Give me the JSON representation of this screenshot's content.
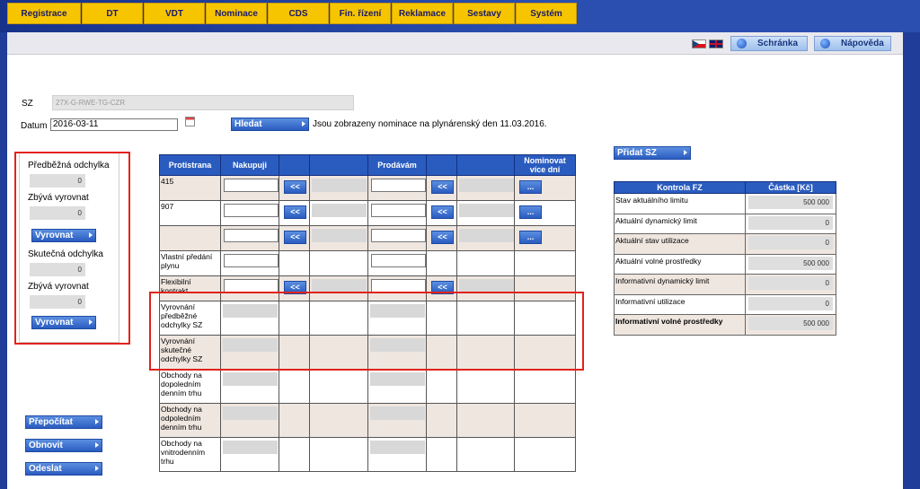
{
  "menu": {
    "items": [
      "Registrace",
      "DT",
      "VDT",
      "Nominace",
      "CDS",
      "Fin. řízení",
      "Reklamace",
      "Sestavy",
      "Systém"
    ]
  },
  "header": {
    "clipboard_label": "Schránka",
    "help_label": "Nápověda"
  },
  "form": {
    "sz_label": "SZ",
    "sz_value": "27X-G-RWE-TG-CZR",
    "date_label": "Datum",
    "date_value": "2016-03-11",
    "search_label": "Hledat",
    "info_text": "Jsou zobrazeny nominace na plynárenský den 11.03.2016."
  },
  "deviation": {
    "prelim_label": "Předběžná odchylka",
    "prelim_value": "0",
    "remaining_label_1": "Zbývá vyrovnat",
    "remaining_value_1": "0",
    "balance_label_1": "Vyrovnat",
    "actual_label": "Skutečná odchylka",
    "actual_value": "0",
    "remaining_label_2": "Zbývá vyrovnat",
    "remaining_value_2": "0",
    "balance_label_2": "Vyrovnat"
  },
  "actions": {
    "recalc_label": "Přepočítat",
    "restore_label": "Obnovit",
    "send_label": "Odeslat",
    "add_sz_label": "Přidat SZ"
  },
  "nomination": {
    "headers": {
      "counterparty": "Protistrana",
      "buy": "Nakupuji",
      "sell": "Prodávám",
      "nominate_multi": "Nominovat více dní"
    },
    "row_labels": [
      "415",
      "907",
      "",
      "Vlastní předání plynu",
      "Flexibilní kontrakt",
      "Vyrovnání předběžné odchylky SZ",
      "Vyrovnání skutečné odchylky SZ",
      "Obchody na dopoledním denním trhu",
      "Obchody na odpoledním denním trhu",
      "Obchody na vnitrodenním trhu"
    ],
    "transfer_label": "<<",
    "multi_label": "..."
  },
  "fz": {
    "headers": {
      "title": "Kontrola FZ",
      "amount": "Částka [Kč]"
    },
    "rows": [
      {
        "label": "Stav aktuálního limitu",
        "value": "500 000"
      },
      {
        "label": "Aktuální dynamický limit",
        "value": "0"
      },
      {
        "label": "Aktuální stav utilizace",
        "value": "0"
      },
      {
        "label": "Aktuální volné prostředky",
        "value": "500 000"
      },
      {
        "label": "Informativní dynamický limit",
        "value": "0"
      },
      {
        "label": "Informativní utilizace",
        "value": "0"
      },
      {
        "label": "Informativní volné prostředky",
        "value": "500 000"
      }
    ]
  },
  "colors": {
    "menu_yellow": "#f7c500",
    "header_blue": "#2a5cc0",
    "highlight_red": "#e2231a"
  }
}
